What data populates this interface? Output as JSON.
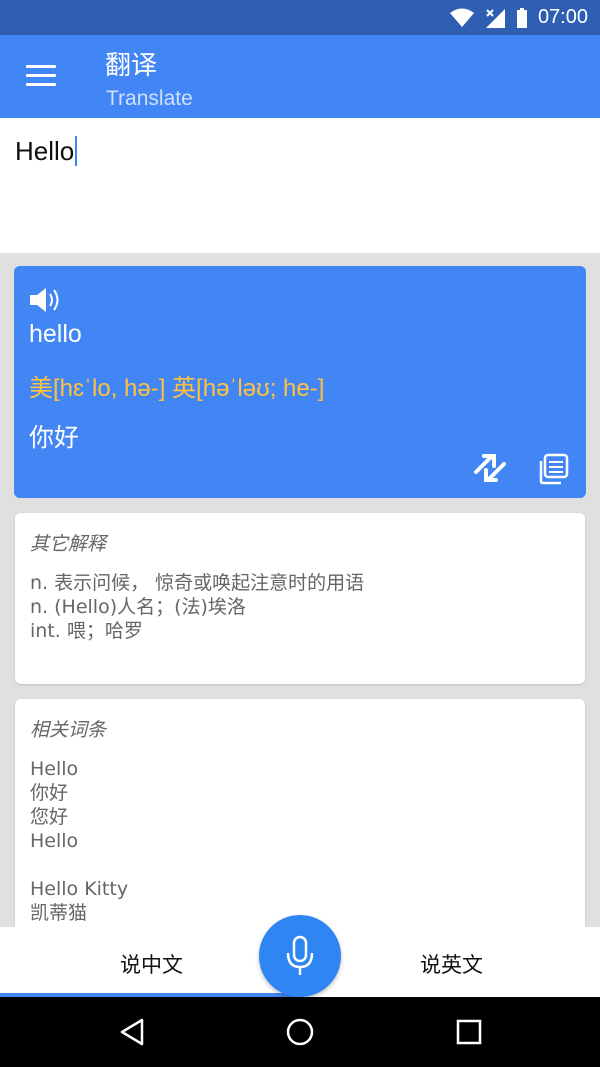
{
  "status": {
    "time": "07:00"
  },
  "appbar": {
    "title": "翻译",
    "subtitle": "Translate"
  },
  "input": {
    "text": "Hello"
  },
  "result": {
    "word": "hello",
    "phonetic": "美[hɛˈlo, hə-] 英[həˈləʊ; he-]",
    "translation": "你好"
  },
  "other_meanings": {
    "heading": "其它解释",
    "lines": [
      "n. 表示问候， 惊奇或唤起注意时的用语",
      "n. (Hello)人名；(法)埃洛",
      "int. 喂；哈罗"
    ]
  },
  "related": {
    "heading": "相关词条",
    "lines": [
      "Hello",
      "你好",
      "您好",
      "Hello",
      "",
      "Hello Kitty",
      "凯蒂猫"
    ]
  },
  "bottom": {
    "tab_chinese": "说中文",
    "tab_english": "说英文"
  },
  "colors": {
    "primary": "#4285f4",
    "status": "#2f5fb3",
    "phonetic": "#ffc23d"
  }
}
